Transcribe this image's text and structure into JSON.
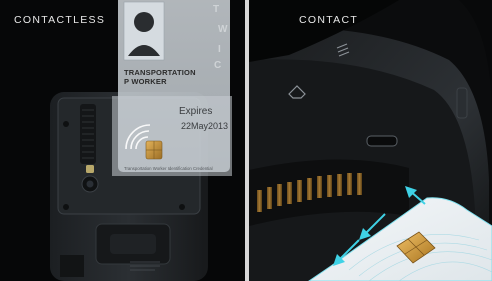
{
  "left_panel": {
    "caption": "CONTACTLESS",
    "card": {
      "name_line_1": "TRANSPORTATION",
      "name_line_2": "P WORKER",
      "side_letters": [
        "T",
        "W",
        "I",
        "C"
      ],
      "expires_label": "Expires",
      "expires_date": "22May2013",
      "footer_text": "Transportation Worker Identification Credential"
    }
  },
  "right_panel": {
    "caption": "CONTACT"
  },
  "colors": {
    "card_tint": "#cfd6dc",
    "chip_gold": "#c9953a",
    "arrow_cyan": "#3fd2e6",
    "divider": "#d8d8d8"
  }
}
